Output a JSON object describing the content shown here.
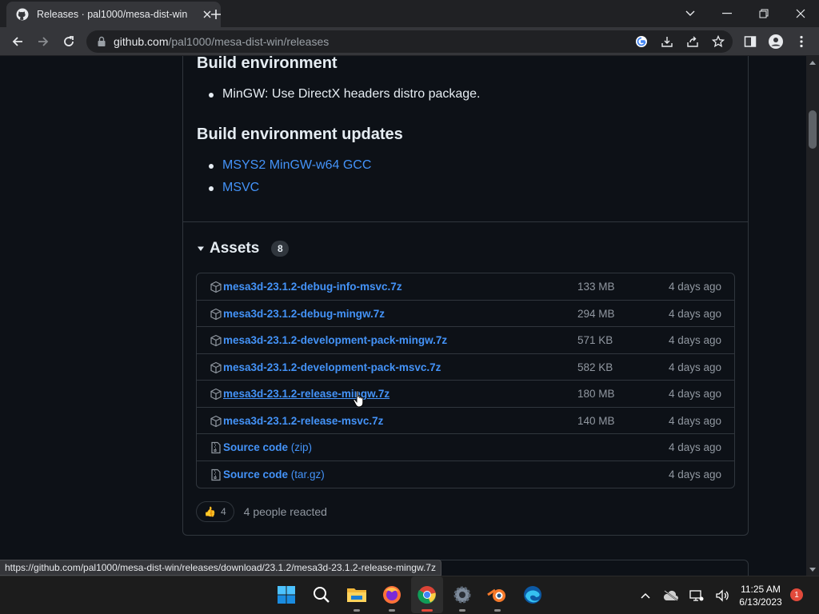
{
  "browser": {
    "tab_title": "Releases · pal1000/mesa-dist-win",
    "url_host": "github.com",
    "url_path": "/pal1000/mesa-dist-win/releases",
    "status_url": "https://github.com/pal1000/mesa-dist-win/releases/download/23.1.2/mesa3d-23.1.2-release-mingw.7z"
  },
  "notes": {
    "build_env_title": "Build environment",
    "build_env_items": [
      "MinGW: Use DirectX headers distro package."
    ],
    "build_env_updates_title": "Build environment updates",
    "build_env_updates_links": [
      "MSYS2 MinGW-w64 GCC",
      "MSVC"
    ]
  },
  "assets": {
    "title": "Assets",
    "count": "8",
    "rows": [
      {
        "name": "mesa3d-23.1.2-debug-info-msvc.7z",
        "size": "133 MB",
        "date": "4 days ago"
      },
      {
        "name": "mesa3d-23.1.2-debug-mingw.7z",
        "size": "294 MB",
        "date": "4 days ago"
      },
      {
        "name": "mesa3d-23.1.2-development-pack-mingw.7z",
        "size": "571 KB",
        "date": "4 days ago"
      },
      {
        "name": "mesa3d-23.1.2-development-pack-msvc.7z",
        "size": "582 KB",
        "date": "4 days ago"
      },
      {
        "name": "mesa3d-23.1.2-release-mingw.7z",
        "size": "180 MB",
        "date": "4 days ago"
      },
      {
        "name": "mesa3d-23.1.2-release-msvc.7z",
        "size": "140 MB",
        "date": "4 days ago"
      },
      {
        "name": "Source code",
        "fmt": "(zip)",
        "size": "",
        "date": "4 days ago"
      },
      {
        "name": "Source code",
        "fmt": "(tar.gz)",
        "size": "",
        "date": "4 days ago"
      }
    ]
  },
  "reactions": {
    "emoji": "👍",
    "count": "4",
    "text": "4 people reacted"
  },
  "taskbar": {
    "time": "11:25 AM",
    "date": "6/13/2023",
    "notifications": "1",
    "apps": [
      "start-icon",
      "search-icon",
      "file-explorer-icon",
      "firefox-icon",
      "chrome-icon",
      "settings-icon",
      "blender-icon",
      "edge-icon"
    ]
  },
  "colors": {
    "link": "#4493f8",
    "bg": "#0d1117",
    "border": "#30363d",
    "muted": "#9198a1"
  }
}
